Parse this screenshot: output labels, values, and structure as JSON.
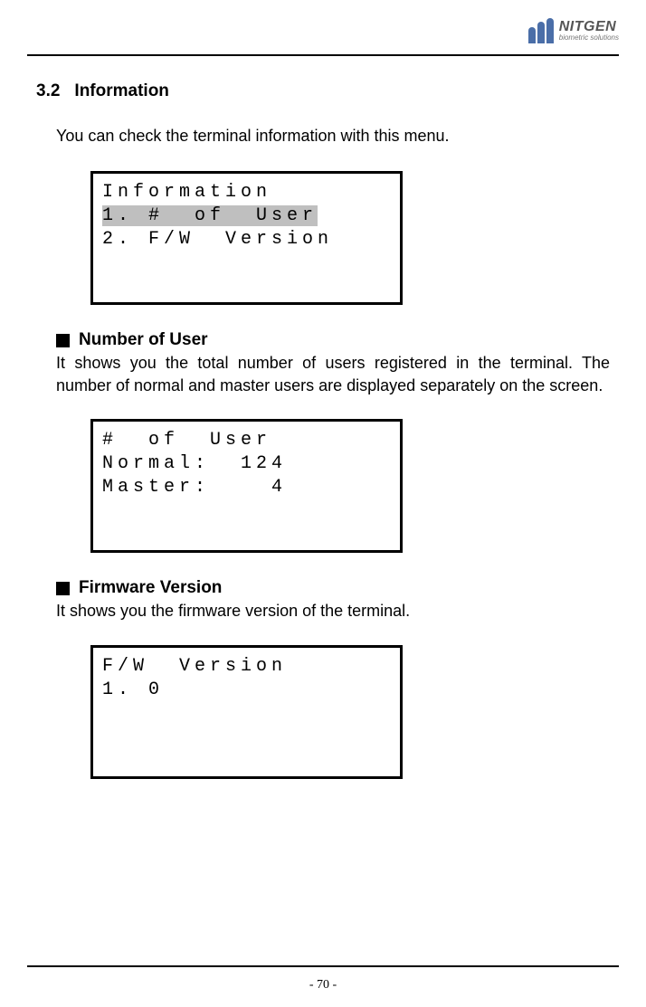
{
  "header": {
    "logo_name": "NITGEN",
    "logo_tagline": "biometric solutions"
  },
  "section": {
    "number": "3.2",
    "title": "Information"
  },
  "intro": "You can check the terminal information with this menu.",
  "lcd1": {
    "line1": "Information",
    "line2": "1. #  of  User",
    "line3": "2. F/W  Version"
  },
  "sub1": {
    "title": "Number of User",
    "desc": "It shows you the total number of users registered in the terminal. The number of normal and master users are displayed separately on the screen."
  },
  "lcd2": {
    "line1": "#  of  User",
    "line2": "Normal:  124",
    "line3": "Master:    4"
  },
  "sub2": {
    "title": "Firmware Version",
    "desc": "It shows you the firmware version of the terminal."
  },
  "lcd3": {
    "line1": "F/W  Version",
    "line2": "1. 0"
  },
  "footer": {
    "page": "- 70 -"
  }
}
